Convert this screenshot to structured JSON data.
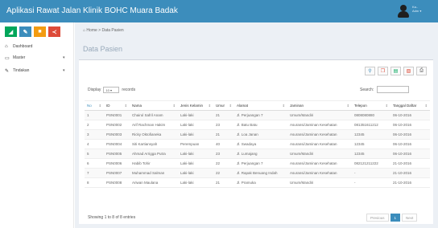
{
  "header": {
    "title": "Aplikasi Rawat Jalan Klinik BOHC Muara Badak",
    "user_line1": "Ka..",
    "user_line2": "Adm ▾"
  },
  "sidebar": {
    "color_buttons": [
      {
        "icon": "chart-icon",
        "glyph": "◢",
        "color": "#00a65a"
      },
      {
        "icon": "pencil-icon",
        "glyph": "✎",
        "color": "#3c8dbc"
      },
      {
        "icon": "users-icon",
        "glyph": "■",
        "color": "#f39c12"
      },
      {
        "icon": "share-icon",
        "glyph": "≺",
        "color": "#dd4b39"
      }
    ],
    "items": [
      {
        "label": "Dashboard",
        "icon": "home-icon",
        "glyph": "⌂",
        "has_chevron": false
      },
      {
        "label": "Master",
        "icon": "monitor-icon",
        "glyph": "▭",
        "has_chevron": true
      },
      {
        "label": "Tindakan",
        "icon": "edit-icon",
        "glyph": "✎",
        "has_chevron": true
      }
    ]
  },
  "breadcrumb": {
    "home": "Home",
    "separator": ">",
    "current": "Data Pasien"
  },
  "page_title": "Data Pasien",
  "toolbar_buttons": [
    {
      "icon": "search-icon",
      "glyph": "⚲",
      "color": "#3c8dbc"
    },
    {
      "icon": "copy-icon",
      "glyph": "❐",
      "color": "#dd4b39"
    },
    {
      "icon": "excel-icon",
      "glyph": "▤",
      "color": "#00a65a"
    },
    {
      "icon": "pdf-icon",
      "glyph": "▧",
      "color": "#dd4b39"
    },
    {
      "icon": "print-icon",
      "glyph": "⎙",
      "color": "#555555"
    }
  ],
  "table_controls": {
    "display_label": "Display",
    "page_size": "10",
    "records_label": "records",
    "search_label": "Search:"
  },
  "table": {
    "columns": [
      "No",
      "ID",
      "Nama",
      "Jenis Kelamin",
      "Umur",
      "Alamat",
      "Jaminan",
      "Telepon",
      "Tanggal Daftar"
    ],
    "rows": [
      [
        "1",
        "PSN0001",
        "Chairul Safril Anam",
        "Laki-laki",
        "21",
        "Jl. Perjuangan 7",
        "Umum/Mandiri",
        "0808080880",
        "06-10-2016"
      ],
      [
        "2",
        "PSN0002",
        "Arif Rachman Hakim",
        "Laki-laki",
        "23",
        "Jl. Batu Batu",
        "Asuransi/Jaminan Kesehatan",
        "081351611212",
        "06-10-2016"
      ],
      [
        "3",
        "PSN0003",
        "Ricky Oktofianeka",
        "Laki-laki",
        "21",
        "Jl. Loa Janan",
        "Asuransi/Jaminan Kesehatan",
        "12345",
        "06-10-2016"
      ],
      [
        "4",
        "PSN0004",
        "Siti Kartiansyah",
        "Perempuan",
        "40",
        "Jl. Swadaya",
        "Asuransi/Jaminan Kesehatan",
        "12345",
        "06-10-2016"
      ],
      [
        "5",
        "PSN0005",
        "Ahmad Arrigga Putra",
        "Laki-laki",
        "23",
        "Jl. Lumajang",
        "Umum/Mandiri",
        "12345",
        "06-10-2016"
      ],
      [
        "6",
        "PSN0006",
        "Habib Tohir",
        "Laki-laki",
        "22",
        "Jl. Perjuangan 7",
        "Asuransi/Jaminan Kesehatan",
        "082121211222",
        "21-10-2016"
      ],
      [
        "7",
        "PSN0007",
        "Muhammad Salman",
        "Laki-laki",
        "22",
        "Jl. Rapak Benuang Indah",
        "Asuransi/Jaminan Kesehatan",
        "-",
        "21-10-2016"
      ],
      [
        "8",
        "PSN0008",
        "Ariwan Maulana",
        "Laki-laki",
        "21",
        "Jl. Pramuka",
        "Umum/Mandiri",
        "-",
        "21-10-2016"
      ]
    ]
  },
  "footer": {
    "showing": "Showing 1 to 8 of 8 entries",
    "previous": "Previous",
    "page": "1",
    "next": "Next"
  }
}
